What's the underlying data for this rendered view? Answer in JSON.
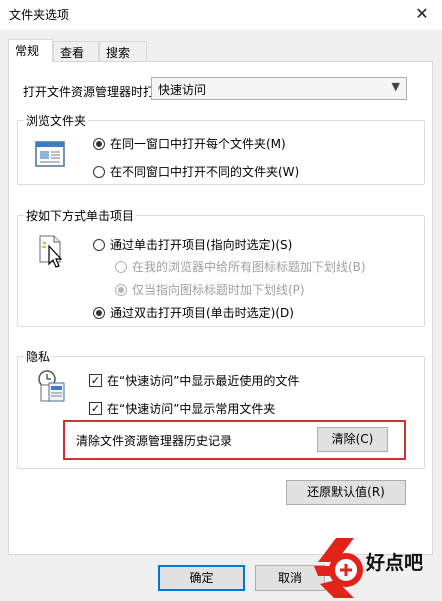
{
  "window": {
    "title": "文件夹选项",
    "close_glyph": "✕"
  },
  "tabs": [
    {
      "label": "常规"
    },
    {
      "label": "查看"
    },
    {
      "label": "搜索"
    }
  ],
  "general": {
    "open_label": "打开文件资源管理器时打",
    "open_value": "快速访问",
    "browse_group": {
      "title": "浏览文件夹",
      "options": [
        {
          "label": "在同一窗口中打开每个文件夹(M)",
          "checked": true
        },
        {
          "label": "在不同窗口中打开不同的文件夹(W)",
          "checked": false
        }
      ]
    },
    "click_group": {
      "title": "按如下方式单击项目",
      "options": [
        {
          "label": "通过单击打开项目(指向时选定)(S)",
          "checked": false
        },
        {
          "label": "在我的浏览器中给所有图标标题加下划线(B)",
          "checked": false,
          "disabled": true
        },
        {
          "label": "仅当指向图标标题时加下划线(P)",
          "checked": true,
          "disabled": true
        },
        {
          "label": "通过双击打开项目(单击时选定)(D)",
          "checked": true
        }
      ]
    },
    "privacy_group": {
      "title": "隐私",
      "checks": [
        {
          "label": "在“快速访问”中显示最近使用的文件",
          "checked": true
        },
        {
          "label": "在“快速访问”中显示常用文件夹",
          "checked": true
        }
      ],
      "clear_label": "清除文件资源管理器历史记录",
      "clear_button": "清除(C)"
    },
    "restore_button": "还原默认值(R)"
  },
  "footer": {
    "ok_button": "确定",
    "cancel_button": "取消"
  },
  "watermark": {
    "text": "好点吧"
  },
  "colors": {
    "highlight": "#d2322d",
    "accent": "#0078d7",
    "watermark_red": "#e2231a"
  }
}
